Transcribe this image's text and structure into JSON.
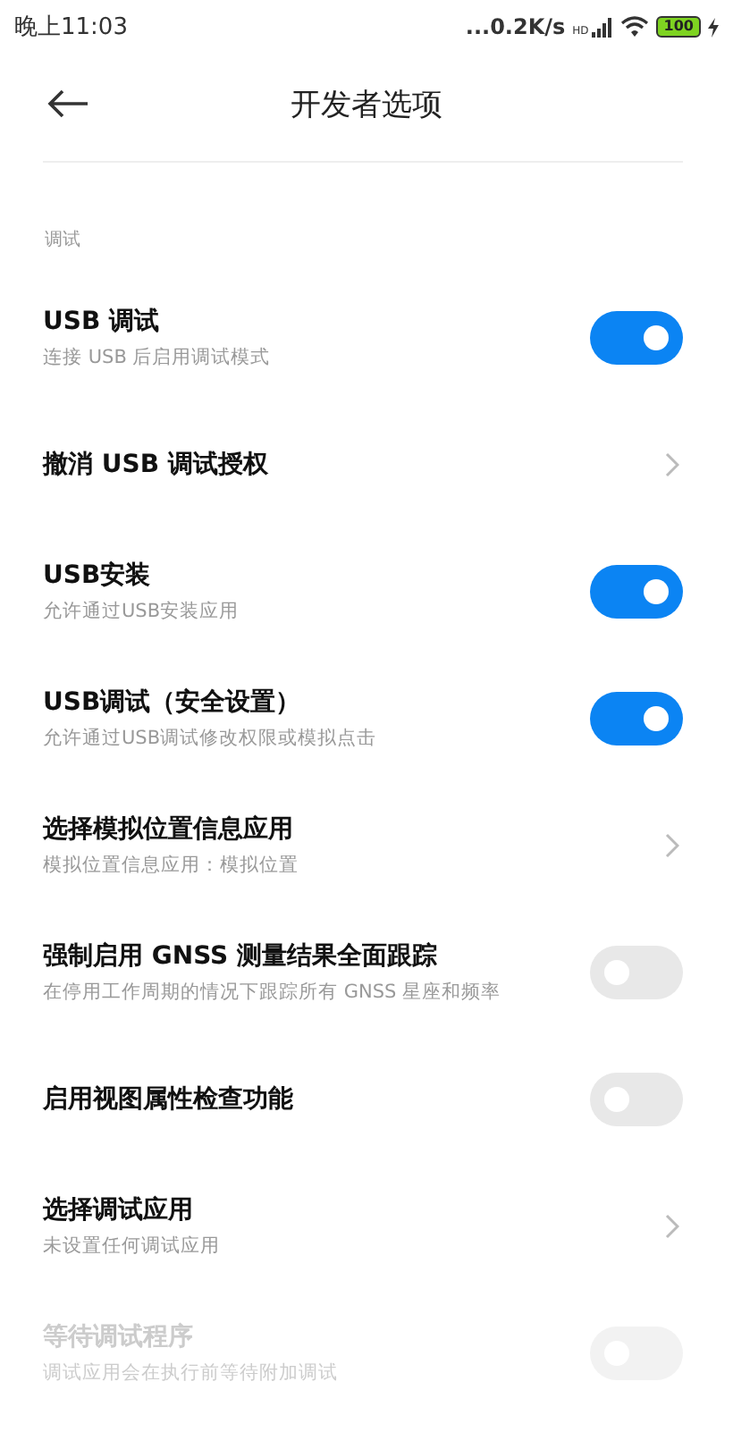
{
  "status_bar": {
    "time": "晚上11:03",
    "network_speed": "...0.2K/s",
    "network_type": "HD",
    "battery": "100"
  },
  "header": {
    "title": "开发者选项"
  },
  "section": {
    "label": "调试"
  },
  "rows": [
    {
      "kind": "switch",
      "title": "USB 调试",
      "subtitle": "连接 USB 后启用调试模式",
      "on": true,
      "disabled": false
    },
    {
      "kind": "link",
      "title": "撤消 USB 调试授权",
      "disabled": false
    },
    {
      "kind": "switch",
      "title": "USB安装",
      "subtitle": "允许通过USB安装应用",
      "on": true,
      "disabled": false
    },
    {
      "kind": "switch",
      "title": "USB调试（安全设置）",
      "subtitle": "允许通过USB调试修改权限或模拟点击",
      "on": true,
      "disabled": false
    },
    {
      "kind": "link",
      "title": "选择模拟位置信息应用",
      "subtitle": "模拟位置信息应用：模拟位置",
      "disabled": false
    },
    {
      "kind": "switch",
      "title": "强制启用 GNSS 测量结果全面跟踪",
      "subtitle": "在停用工作周期的情况下跟踪所有 GNSS 星座和频率",
      "on": false,
      "disabled": false
    },
    {
      "kind": "switch",
      "title": "启用视图属性检查功能",
      "on": false,
      "disabled": false
    },
    {
      "kind": "link",
      "title": "选择调试应用",
      "subtitle": "未设置任何调试应用",
      "disabled": false
    },
    {
      "kind": "switch",
      "title": "等待调试程序",
      "subtitle": "调试应用会在执行前等待附加调试",
      "on": false,
      "disabled": true
    }
  ]
}
